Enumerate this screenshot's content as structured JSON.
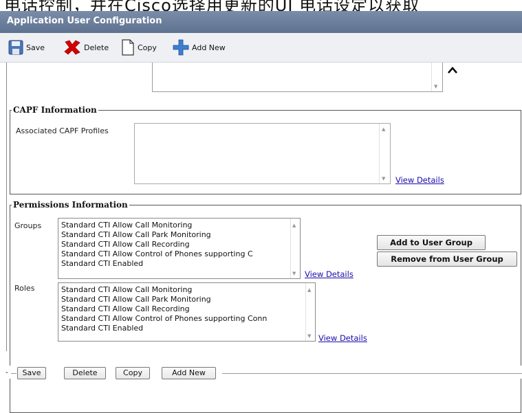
{
  "banner": {
    "text": "电话控制，并在Cisco选择用更新的UI 电话设定以获取"
  },
  "window": {
    "title": "Application User Configuration"
  },
  "toolbar": {
    "save_label": "Save",
    "delete_label": "Delete",
    "copy_label": "Copy",
    "add_new_label": "Add New"
  },
  "capf": {
    "legend": "CAPF Information",
    "profiles_label": "Associated CAPF Profiles",
    "view_details": "View Details"
  },
  "permissions": {
    "legend": "Permissions Information",
    "groups_label": "Groups",
    "groups": [
      "Standard CTI Allow Call Monitoring",
      "Standard CTI Allow Call Park Monitoring",
      "Standard CTI Allow Call Recording",
      "Standard CTI Allow Control of Phones supporting C",
      "Standard CTI Enabled"
    ],
    "groups_view_details": "View Details",
    "add_to_group": "Add to User Group",
    "remove_from_group": "Remove from User Group",
    "roles_label": "Roles",
    "roles": [
      "Standard CTI Allow Call Monitoring",
      "Standard CTI Allow Call Park Monitoring",
      "Standard CTI Allow Call Recording",
      "Standard CTI Allow Control of Phones supporting Conn",
      "Standard CTI Enabled"
    ],
    "roles_view_details": "View Details"
  },
  "bottom": {
    "dash": "-",
    "save_label": "Save",
    "delete_label": "Delete",
    "copy_label": "Copy",
    "add_new_label": "Add New"
  },
  "icons": {
    "save": "floppy-disk-icon",
    "delete": "red-x-icon",
    "copy": "document-icon",
    "add_new": "blue-plus-icon"
  },
  "colors": {
    "titlebar": "#6b7f9c",
    "link": "#1a0dab",
    "delete_icon": "#d40000",
    "add_icon": "#3c7fd0"
  }
}
